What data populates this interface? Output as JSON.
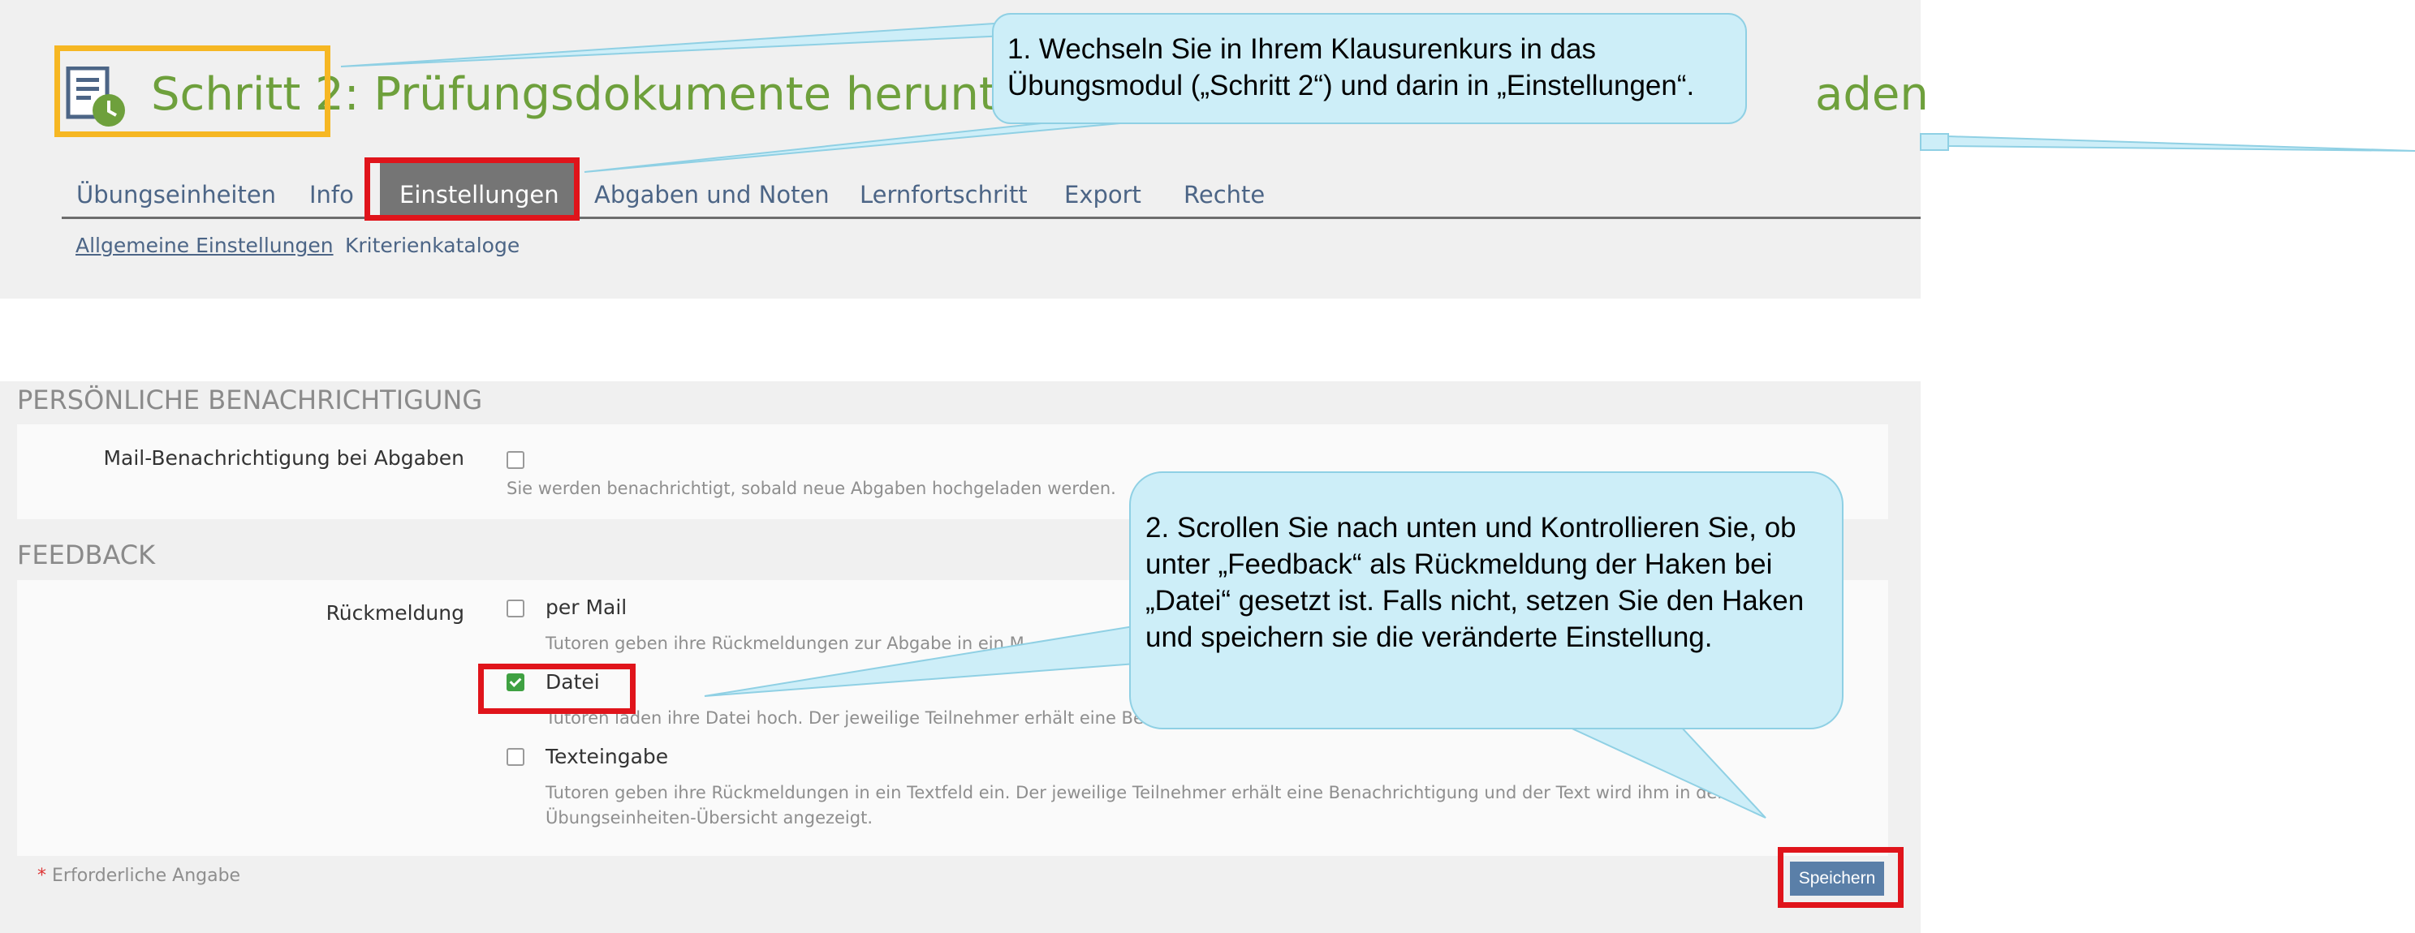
{
  "top": {
    "title": "Schritt 2: Prüfungsdokumente herunter",
    "title_tail": "aden",
    "icon": "assignment-clock-icon",
    "tabs": [
      "Übungseinheiten",
      "Info",
      "Einstellungen",
      "Abgaben und Noten",
      "Lernfortschritt",
      "Export",
      "Rechte"
    ],
    "active_tab": "Einstellungen",
    "subtabs": [
      "Allgemeine Einstellungen",
      "Kriterienkataloge"
    ]
  },
  "notification": {
    "heading": "PERSÖNLICHE BENACHRICHTIGUNG",
    "label": "Mail-Benachrichtigung bei Abgaben",
    "checked": false,
    "help": "Sie werden benachrichtigt, sobald neue Abgaben hochgeladen werden."
  },
  "feedback": {
    "heading": "FEEDBACK",
    "label": "Rückmeldung",
    "options": [
      {
        "label": "per Mail",
        "checked": false,
        "help": "Tutoren geben ihre Rückmeldungen zur Abgabe in ein M"
      },
      {
        "label": "Datei",
        "checked": true,
        "help": "Tutoren laden ihre Datei hoch. Der jeweilige Teilnehmer erhält eine Bena"
      },
      {
        "label": "Texteingabe",
        "checked": false,
        "help": "Tutoren geben ihre Rückmeldungen in ein Textfeld ein. Der jeweilige Teilnehmer erhält eine Benachrichtigung und der Text wird ihm in der Übungseinheiten-Übersicht angezeigt."
      }
    ]
  },
  "footer": {
    "required_star": "*",
    "required_label": "Erforderliche Angabe",
    "save_label": "Speichern"
  },
  "callouts": [
    {
      "text": "1. Wechseln Sie in Ihrem Klausurenkurs in das Übungsmodul („Schritt 2“) und darin in „Einstellungen“."
    },
    {
      "text": "2. Scrollen Sie nach unten und Kontrollieren Sie, ob unter „Feedback“ als Rückmeldung der Haken bei „Datei“ gesetzt ist. Falls nicht, setzen Sie den Haken und speichern sie die veränderte Einstellung."
    }
  ],
  "colors": {
    "title_green": "#6ea03c",
    "highlight_red": "#e0141b",
    "highlight_yellow": "#f6b723",
    "callout_fill": "#cdeef8",
    "checkbox_green": "#3fa142",
    "button_blue": "#5a7fa8"
  }
}
